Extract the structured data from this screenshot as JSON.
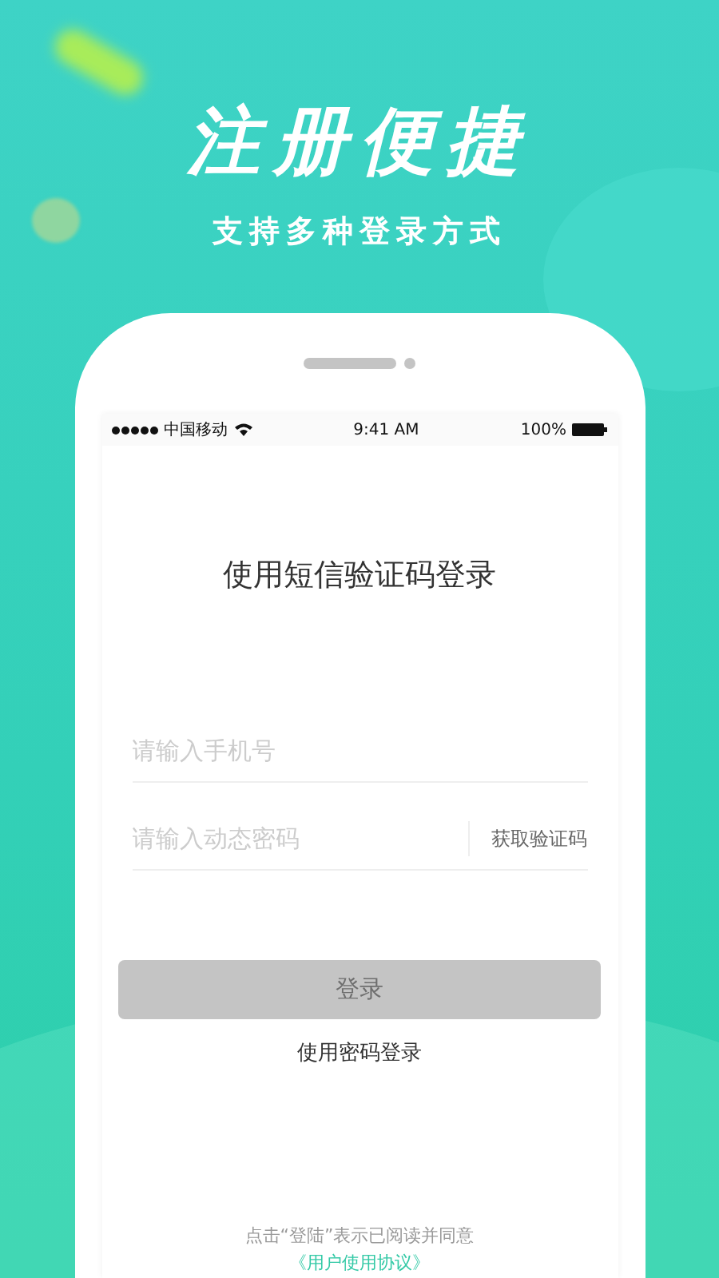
{
  "headline": "注册便捷",
  "subheadline": "支持多种登录方式",
  "status_bar": {
    "carrier": "中国移动",
    "time": "9:41 AM",
    "battery": "100%"
  },
  "title": "使用短信验证码登录",
  "phone_field": {
    "placeholder": "请输入手机号"
  },
  "code_field": {
    "placeholder": "请输入动态密码"
  },
  "get_code_button": "获取验证码",
  "login_button": {
    "label": "登录",
    "disabled": true
  },
  "password_login_link": "使用密码登录",
  "agreement": {
    "text": "点击“登陆”表示已阅读并同意",
    "link": "《用户使用协议》"
  }
}
